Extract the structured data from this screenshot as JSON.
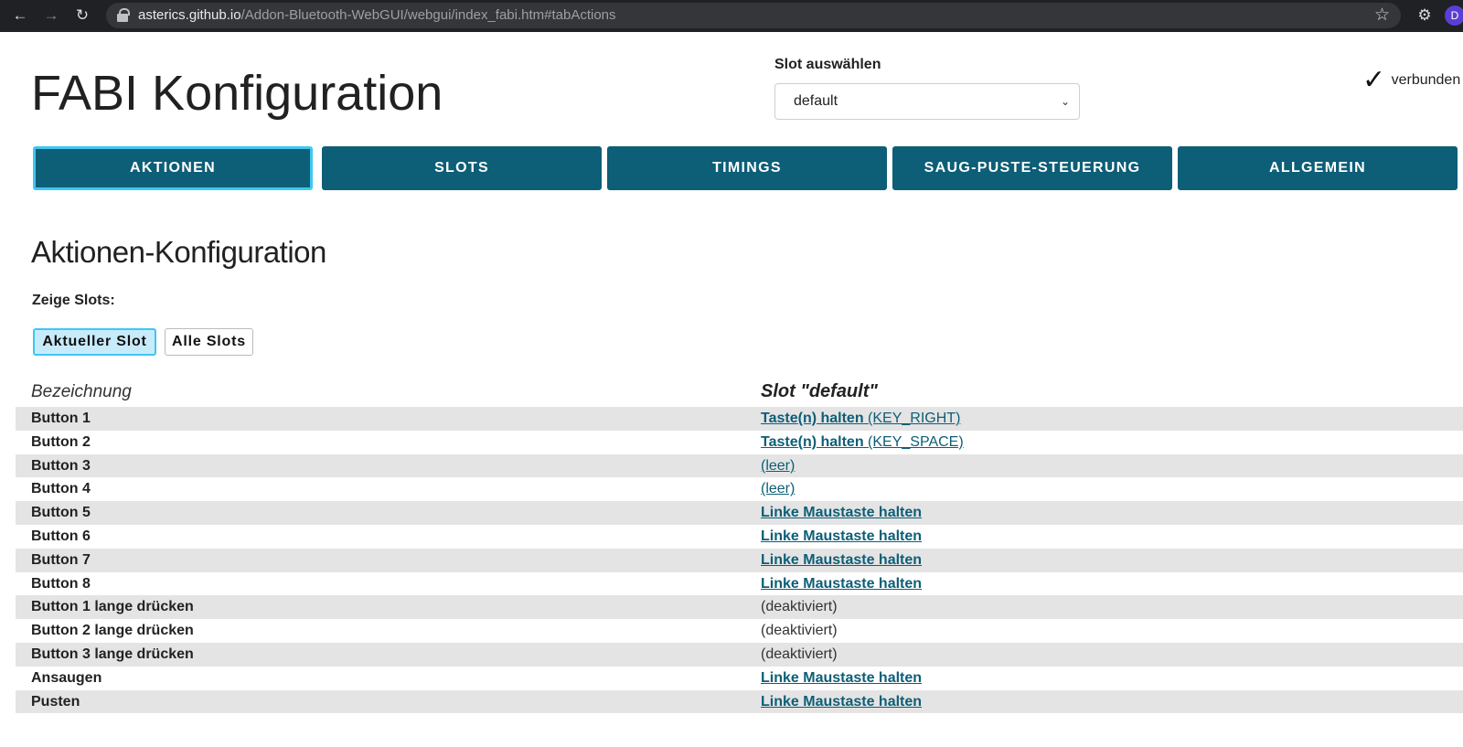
{
  "browser": {
    "url_host": "asterics.github.io",
    "url_path": "/Addon-Bluetooth-WebGUI/webgui/index_fabi.htm#tabActions",
    "profile_initial": "D"
  },
  "header": {
    "title": "FABI Konfiguration",
    "slot_label": "Slot auswählen",
    "slot_selected": "default",
    "connection_status": "verbunden"
  },
  "tabs": [
    {
      "label": "AKTIONEN",
      "active": true
    },
    {
      "label": "SLOTS",
      "active": false
    },
    {
      "label": "TIMINGS",
      "active": false
    },
    {
      "label": "SAUG-PUSTE-STEUERUNG",
      "active": false
    },
    {
      "label": "ALLGEMEIN",
      "active": false
    }
  ],
  "section": {
    "title": "Aktionen-Konfiguration",
    "show_slots_label": "Zeige Slots:",
    "btn_current": "Aktueller Slot",
    "btn_all": "Alle Slots"
  },
  "table": {
    "col_name": "Bezeichnung",
    "col_slot": "Slot \"default\"",
    "rows": [
      {
        "name": "Button 1",
        "action_bold": "Taste(n) halten",
        "action_detail": " (KEY_RIGHT)"
      },
      {
        "name": "Button 2",
        "action_bold": "Taste(n) halten",
        "action_detail": " (KEY_SPACE)"
      },
      {
        "name": "Button 3",
        "action_bold": "",
        "action_detail": "(leer)"
      },
      {
        "name": "Button 4",
        "action_bold": "",
        "action_detail": "(leer)"
      },
      {
        "name": "Button 5",
        "action_bold": "Linke Maustaste halten",
        "action_detail": ""
      },
      {
        "name": "Button 6",
        "action_bold": "Linke Maustaste halten",
        "action_detail": ""
      },
      {
        "name": "Button 7",
        "action_bold": "Linke Maustaste halten",
        "action_detail": ""
      },
      {
        "name": "Button 8",
        "action_bold": "Linke Maustaste halten",
        "action_detail": ""
      },
      {
        "name": "Button 1 lange drücken",
        "action_bold": "",
        "action_detail": "(deaktiviert)",
        "disabled": true
      },
      {
        "name": "Button 2 lange drücken",
        "action_bold": "",
        "action_detail": "(deaktiviert)",
        "disabled": true
      },
      {
        "name": "Button 3 lange drücken",
        "action_bold": "",
        "action_detail": "(deaktiviert)",
        "disabled": true
      },
      {
        "name": "Ansaugen",
        "action_bold": "Linke Maustaste halten",
        "action_detail": ""
      },
      {
        "name": "Pusten",
        "action_bold": "Linke Maustaste halten",
        "action_detail": ""
      }
    ]
  }
}
